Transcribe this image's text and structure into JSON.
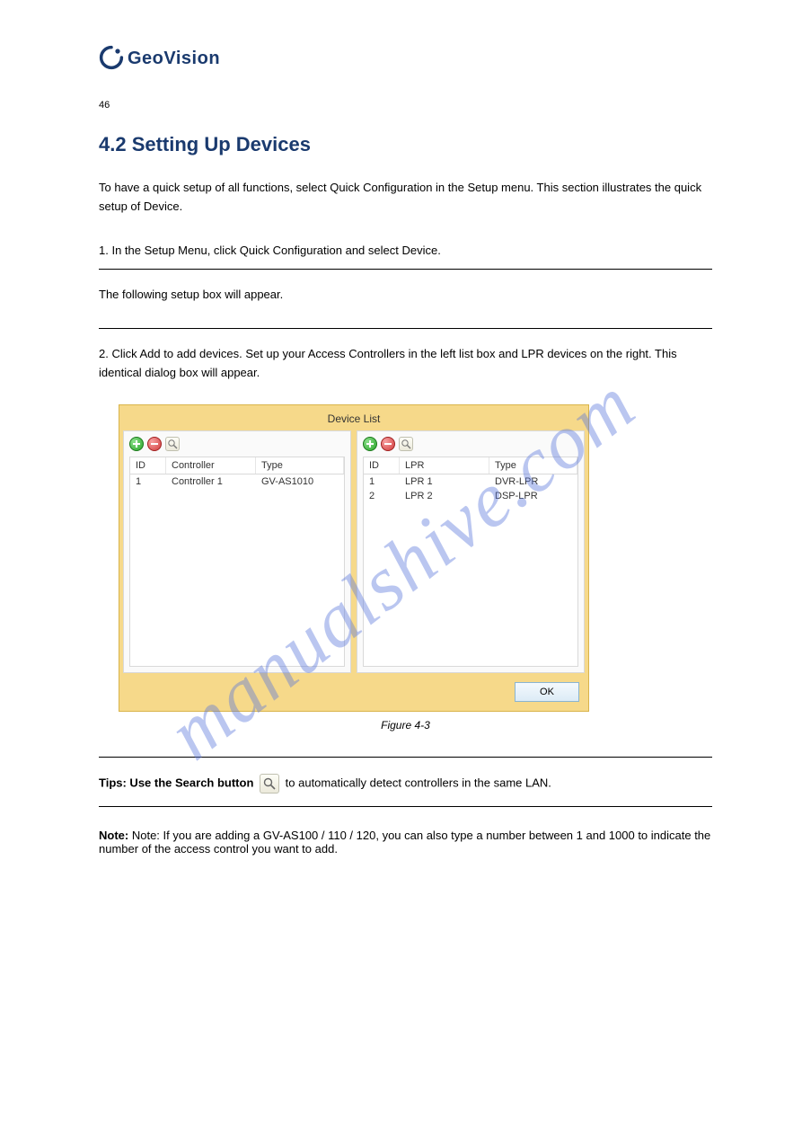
{
  "brand": {
    "name": "GeoVision"
  },
  "page_number": "46",
  "section_title": "4.2  Setting Up Devices",
  "intro": "To have a quick setup of all functions, select Quick Configuration in the Setup menu. This section illustrates the quick setup of Device.",
  "para1_line1": "1. In the Setup Menu, click Quick Configuration and select Device.",
  "para1_line2": "   The following setup box will appear.",
  "listbox_intro": "2. Click Add to add devices. Set up your Access Controllers in the left list box and LPR devices on the right. This identical dialog box will appear.",
  "figure_caption": "Figure 4-3",
  "device_list": {
    "title": "Device List",
    "ok": "OK",
    "left": {
      "headers": {
        "id": "ID",
        "controller": "Controller",
        "type": "Type"
      },
      "rows": [
        {
          "id": "1",
          "controller": "Controller 1",
          "type": "GV-AS1010"
        }
      ]
    },
    "right": {
      "headers": {
        "id": "ID",
        "lpr": "LPR",
        "type": "Type"
      },
      "rows": [
        {
          "id": "1",
          "lpr": "LPR 1",
          "type": "DVR-LPR"
        },
        {
          "id": "2",
          "lpr": "LPR 2",
          "type": "DSP-LPR"
        }
      ]
    }
  },
  "tip": {
    "prefix": "Tips: Use the Search button",
    "suffix": "to automatically detect controllers in the same LAN."
  },
  "note": "Note: If you are adding a GV-AS100 / 110 / 120, you can also type a number between 1 and 1000 to indicate the number of the access control you want to add."
}
